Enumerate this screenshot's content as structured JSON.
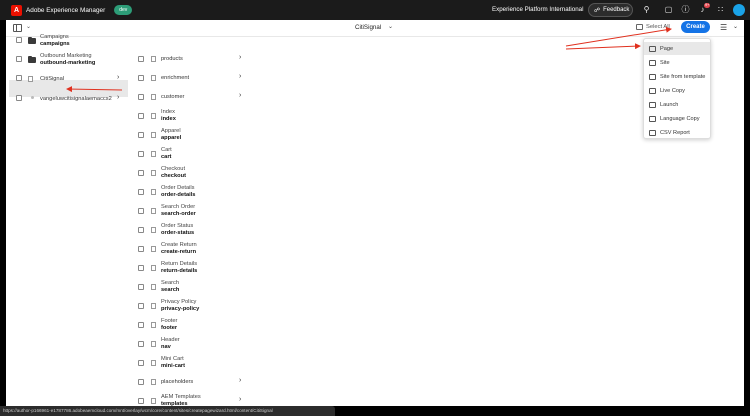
{
  "shell": {
    "logo_letter": "A",
    "app_title": "Adobe Experience Manager",
    "env_badge": "dev",
    "org_name": "Experience Platform International",
    "feedback_label": "Feedback",
    "notification_count": "9+"
  },
  "toolbar": {
    "breadcrumb": "CitiSignal",
    "select_all_label": "Select All",
    "create_label": "Create"
  },
  "column1": [
    {
      "title": "Campaigns",
      "name": "campaigns",
      "icon": "folder-icon"
    },
    {
      "title": "Outbound Marketing",
      "name": "outbound-marketing",
      "icon": "folder-icon"
    },
    {
      "title": "CitiSignal",
      "name": "",
      "icon": "page-icon",
      "selected": true
    },
    {
      "title": "vangeluwcitisignalaemaccs2",
      "name": "",
      "icon": "dot-icon"
    }
  ],
  "column2": [
    {
      "title": "products",
      "name": "",
      "has_children": true,
      "icon": "page-icon"
    },
    {
      "title": "enrichment",
      "name": "",
      "has_children": true,
      "icon": "page-icon"
    },
    {
      "title": "customer",
      "name": "",
      "has_children": true,
      "icon": "page-icon"
    },
    {
      "title": "Index",
      "name": "index",
      "icon": "page-icon"
    },
    {
      "title": "Apparel",
      "name": "apparel",
      "icon": "page-icon"
    },
    {
      "title": "Cart",
      "name": "cart",
      "icon": "page-icon"
    },
    {
      "title": "Checkout",
      "name": "checkout",
      "icon": "page-icon"
    },
    {
      "title": "Order Details",
      "name": "order-details",
      "icon": "page-icon"
    },
    {
      "title": "Search Order",
      "name": "search-order",
      "icon": "page-icon"
    },
    {
      "title": "Order Status",
      "name": "order-status",
      "icon": "page-icon"
    },
    {
      "title": "Create Return",
      "name": "create-return",
      "icon": "page-icon"
    },
    {
      "title": "Return Details",
      "name": "return-details",
      "icon": "page-icon"
    },
    {
      "title": "Search",
      "name": "search",
      "icon": "page-icon"
    },
    {
      "title": "Privacy Policy",
      "name": "privacy-policy",
      "icon": "page-icon"
    },
    {
      "title": "Footer",
      "name": "footer",
      "icon": "page-icon"
    },
    {
      "title": "Header",
      "name": "nav",
      "icon": "page-icon"
    },
    {
      "title": "Mini Cart",
      "name": "mini-cart",
      "icon": "page-icon"
    },
    {
      "title": "placeholders",
      "name": "",
      "has_children": true,
      "icon": "page-icon"
    },
    {
      "title": "AEM Templates",
      "name": "templates",
      "has_children": true,
      "icon": "page-icon"
    }
  ],
  "create_menu": {
    "items": [
      {
        "label": "Page",
        "icon": "page-icon",
        "highlighted": true
      },
      {
        "label": "Site",
        "icon": "site-icon"
      },
      {
        "label": "Site from template",
        "icon": "site-template-icon"
      },
      {
        "label": "Live Copy",
        "icon": "live-copy-icon"
      },
      {
        "label": "Launch",
        "icon": "launch-icon"
      },
      {
        "label": "Language Copy",
        "icon": "language-copy-icon"
      },
      {
        "label": "CSV Report",
        "icon": "csv-report-icon"
      }
    ]
  },
  "status_bar": {
    "url": "https://author-p166961-e1787786.adobeaemcloud.com/mnt/overlay/wcm/core/content/sites/createpagewizard.html/content/CitiSignal"
  },
  "colors": {
    "accent": "#1473e6",
    "annotation_arrow": "#e0301e",
    "env_badge": "#2d9d78",
    "logo": "#eb1000"
  }
}
